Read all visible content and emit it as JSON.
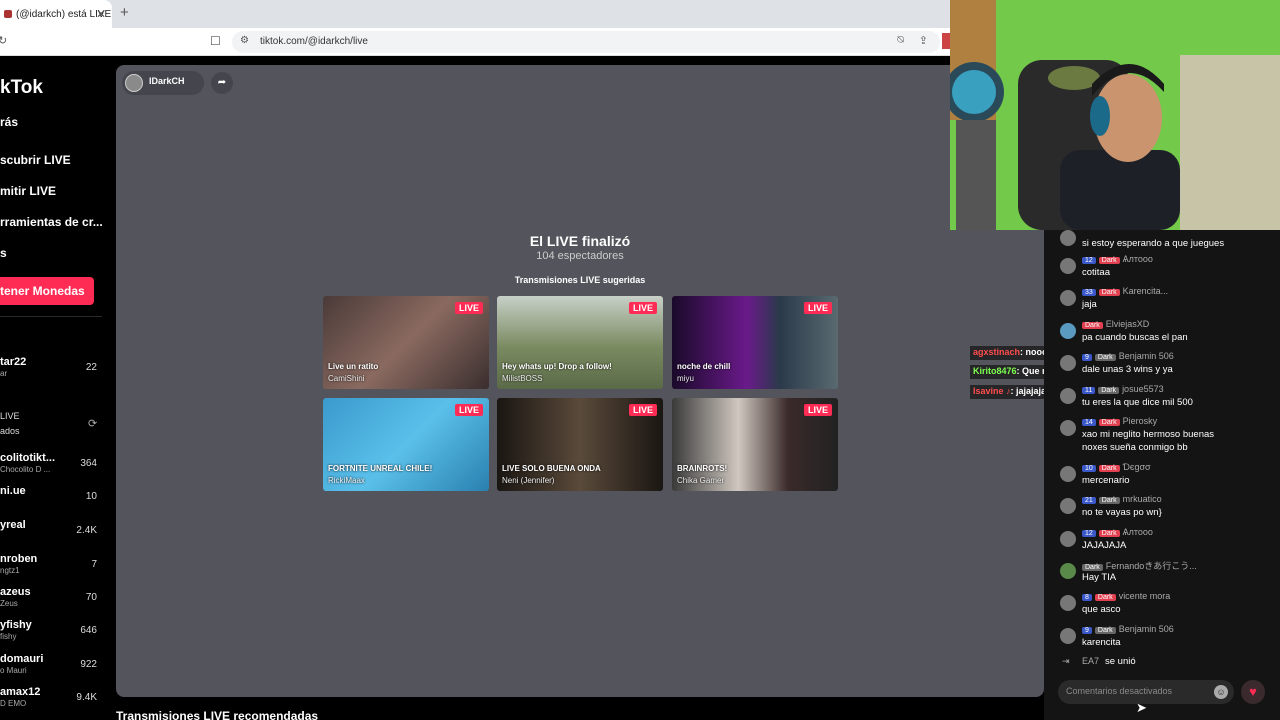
{
  "browser": {
    "tab_title": "(@idarkch) está LIVE",
    "new_tab": "+",
    "url": "tiktok.com/@idarkch/live"
  },
  "sidebar": {
    "brand": "kTok",
    "nav": [
      "rás",
      "scubrir LIVE",
      "mitir LIVE",
      "rramientas de cr...",
      "s"
    ],
    "coins_button": "tener Monedas",
    "accounts": [
      {
        "name": "tar22",
        "sub": "ar",
        "count": "22"
      },
      {
        "name": "colitotikt...",
        "sub": "Chocolito D ...",
        "count": "364"
      },
      {
        "name": "ni.ue",
        "sub": "",
        "count": "10"
      },
      {
        "name": "yreal",
        "sub": "",
        "count": "2.4K"
      },
      {
        "name": "nroben",
        "sub": "ngtz1",
        "count": "7"
      },
      {
        "name": "azeus",
        "sub": "Zeus",
        "count": "70"
      },
      {
        "name": "yfishy",
        "sub": "fishy",
        "count": "646"
      },
      {
        "name": "domauri",
        "sub": "o Mauri",
        "count": "922"
      },
      {
        "name": "amax12",
        "sub": "D EMO",
        "count": "9.4K"
      }
    ],
    "live_header": [
      "LIVE",
      "ados"
    ]
  },
  "player": {
    "host": "IDarkCH",
    "ended_title": "El LIVE finalizó",
    "viewers": "104 espectadores",
    "suggested_title": "Transmisiones LIVE sugeridas",
    "live_badge": "LIVE",
    "cards": [
      {
        "title": "Live un ratito",
        "host": "CamiShini"
      },
      {
        "title": "Hey whats up! Drop a follow!",
        "host": "MilistBOSS"
      },
      {
        "title": "noche de chill",
        "host": "miyu"
      },
      {
        "title": "FORTNITE UNREAL CHILE!",
        "host": "RickiMaax"
      },
      {
        "title": "LIVE SOLO BUENA ONDA",
        "host": "Neni (Jennifer)"
      },
      {
        "title": "BRAINROTS!",
        "host": "Chika Gamer"
      }
    ]
  },
  "bottom_title": "Transmisiones LIVE recomendadas",
  "overlay_chat": [
    {
      "user": "agxstinach",
      "text": ": nooo"
    },
    {
      "user": "Kirito8476",
      "text": ": Que rata"
    },
    {
      "user": "Isavine ♪",
      "text": ": jajajajaja"
    }
  ],
  "chat": {
    "messages": [
      {
        "level": "",
        "badge": "",
        "user": "",
        "text": "si estoy esperando a que juegues"
      },
      {
        "level": "12",
        "badge": "Dark",
        "user": "Ѧлтооо",
        "text": "cotitaa"
      },
      {
        "level": "33",
        "badge": "Dark",
        "user": "Karencita...",
        "text": "jaja"
      },
      {
        "level": "",
        "badge": "Dark",
        "user": "ElviejasXD",
        "text": "pa cuando buscas el pan"
      },
      {
        "level": "9",
        "badge": "Dark",
        "user": "Benjamin 506",
        "text": "dale unas 3 wins y ya"
      },
      {
        "level": "11",
        "badge": "Dark",
        "user": "josue5573",
        "text": "tu eres la que dice mil 500"
      },
      {
        "level": "14",
        "badge": "Dark",
        "user": "Pierosky",
        "text": "xao mi neglito hermoso buenas"
      },
      {
        "level": "",
        "badge": "",
        "user": "",
        "text": "noxes sueña conmigo bb"
      },
      {
        "level": "10",
        "badge": "Dark",
        "user": "Ɗєgσσ",
        "text": "mercenario"
      },
      {
        "level": "21",
        "badge": "Dark",
        "user": "mrkuatico",
        "text": "no te vayas po wn}"
      },
      {
        "level": "12",
        "badge": "Dark",
        "user": "Ѧлтооо",
        "text": "JAJAJAJA"
      },
      {
        "level": "",
        "badge": "Dark",
        "user": "Fernandoきあ行こう...",
        "text": "Hay TIA"
      },
      {
        "level": "8",
        "badge": "Dark",
        "user": "vicente mora",
        "text": "que asco"
      },
      {
        "level": "9",
        "badge": "Dark",
        "user": "Benjamin 506",
        "text": "karencita"
      }
    ],
    "joined": {
      "user": "EA7",
      "text": "se unió"
    },
    "input_placeholder": "Comentarios desactivados"
  }
}
